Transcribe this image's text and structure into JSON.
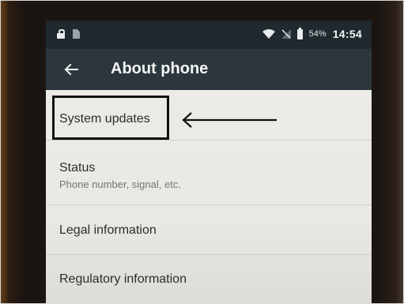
{
  "status_bar": {
    "battery_percent": "54%",
    "time": "14:54",
    "icons": [
      "lock-icon",
      "sim-icon",
      "wifi-icon",
      "no-signal-icon",
      "battery-icon"
    ]
  },
  "toolbar": {
    "back_icon": "arrow-left",
    "title": "About phone"
  },
  "settings_list": {
    "items": [
      {
        "title": "System updates",
        "subtitle": ""
      },
      {
        "title": "Status",
        "subtitle": "Phone number, signal, etc."
      },
      {
        "title": "Legal information",
        "subtitle": ""
      },
      {
        "title": "Regulatory information",
        "subtitle": ""
      }
    ]
  },
  "annotation": {
    "highlight_color": "#111111",
    "arrow_direction": "left"
  },
  "colors": {
    "status_bar_bg": "#1f292e",
    "toolbar_bg": "#2b373d",
    "list_bg": "#ecebe7"
  }
}
